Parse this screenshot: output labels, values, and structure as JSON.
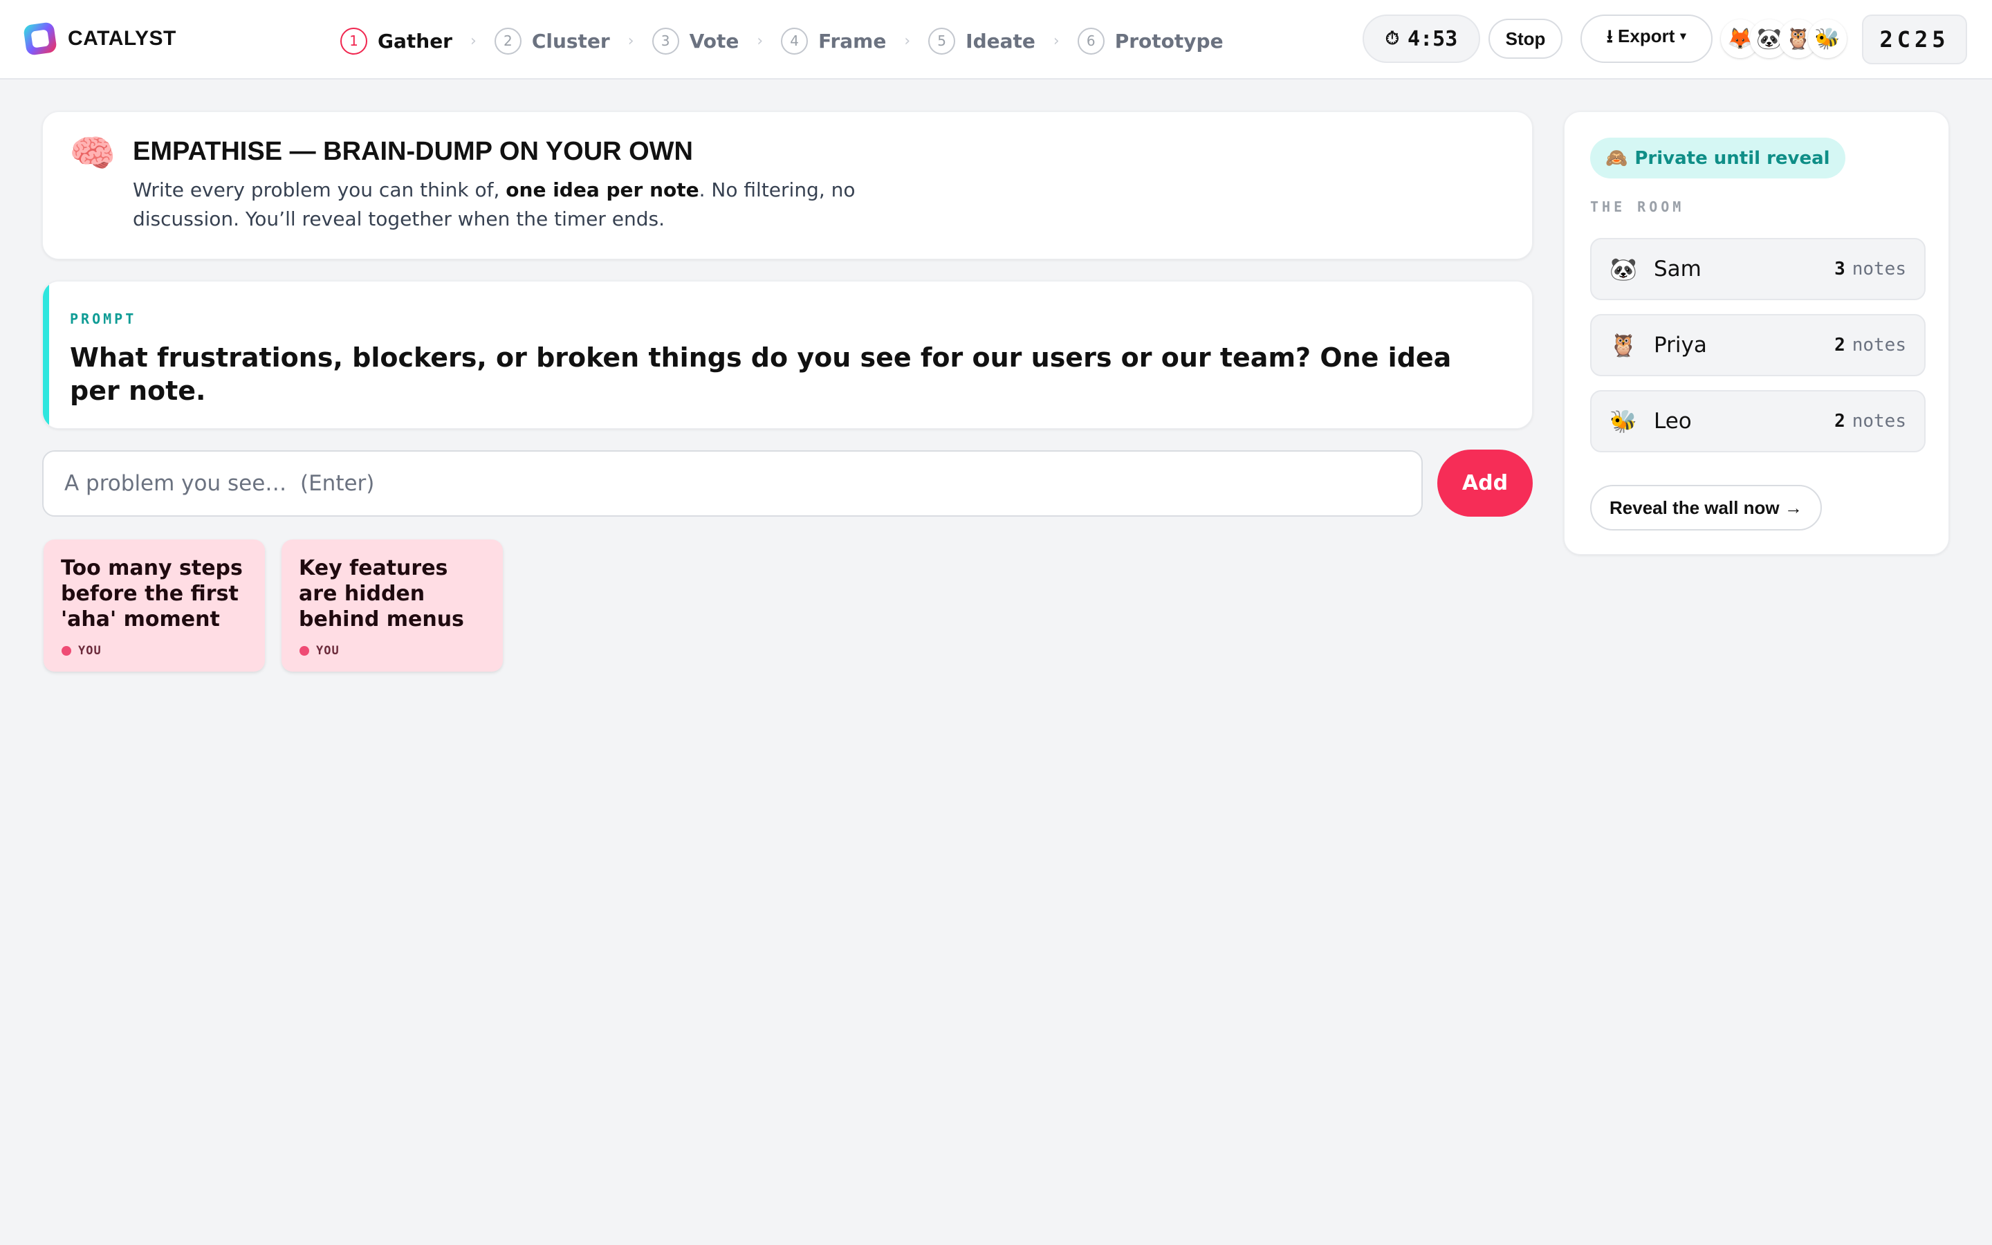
{
  "app": {
    "name": "CATALYST",
    "colors": {
      "accent": "#f62d57",
      "teal": "#2ee6de",
      "note": "#ffdde4"
    }
  },
  "steps": [
    {
      "num": "1",
      "label": "Gather",
      "active": true
    },
    {
      "num": "2",
      "label": "Cluster",
      "active": false
    },
    {
      "num": "3",
      "label": "Vote",
      "active": false
    },
    {
      "num": "4",
      "label": "Frame",
      "active": false
    },
    {
      "num": "5",
      "label": "Ideate",
      "active": false
    },
    {
      "num": "6",
      "label": "Prototype",
      "active": false
    }
  ],
  "step_separator": "›",
  "timer": {
    "icon": "⏱",
    "value": "4:53"
  },
  "stop_label": "Stop",
  "export_label": "⭳ Export ▾",
  "avatars": [
    "🦊",
    "🐼",
    "🦉",
    "🐝"
  ],
  "room_code": "2C25",
  "phase": {
    "emoji": "🧠",
    "title": "EMPATHISE — BRAIN-DUMP ON YOUR OWN",
    "desc_before": "Write every problem you can think of, ",
    "desc_bold": "one idea per note",
    "desc_after": ". No filtering, no discussion. You’ll reveal together when the timer ends."
  },
  "prompt": {
    "label": "PROMPT",
    "text": "What frustrations, blockers, or broken things do you see for our users or our team? One idea per note."
  },
  "input": {
    "placeholder": "A problem you see…  (Enter)",
    "value": ""
  },
  "add_label": "Add",
  "notes": [
    {
      "text": "Too many steps before the first 'aha' moment",
      "author": "YOU"
    },
    {
      "text": "Key features are hidden behind menus",
      "author": "YOU"
    }
  ],
  "side": {
    "private_icon": "🙈",
    "private_label": "Private until reveal",
    "room_label": "THE ROOM",
    "members": [
      {
        "emoji": "🐼",
        "name": "Sam",
        "count": "3",
        "unit": "notes"
      },
      {
        "emoji": "🦉",
        "name": "Priya",
        "count": "2",
        "unit": "notes"
      },
      {
        "emoji": "🐝",
        "name": "Leo",
        "count": "2",
        "unit": "notes"
      }
    ],
    "reveal_label": "Reveal the wall now →"
  }
}
